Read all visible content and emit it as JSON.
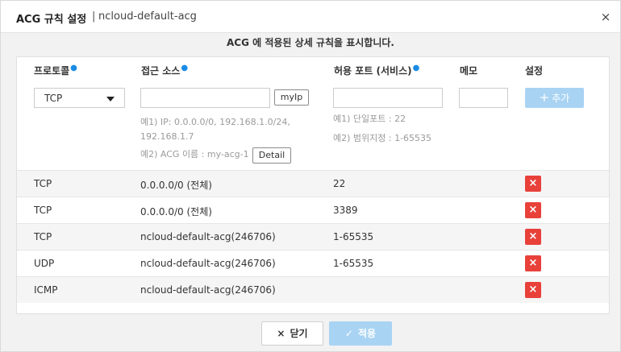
{
  "dialog": {
    "title": "ACG 규칙 설정",
    "separator": "|",
    "acg_name": "ncloud-default-acg",
    "close_icon": "×"
  },
  "description": "ACG 에 적용된 상세 규칙을 표시합니다.",
  "columns": {
    "protocol": "프로토콜",
    "source": "접근 소스",
    "port": "허용 포트 (서비스)",
    "memo": "메모",
    "setting": "설정"
  },
  "form": {
    "protocol_selected": "TCP",
    "source_value": "",
    "myip_button": "myIp",
    "source_hint_1": "예1) IP: 0.0.0.0/0, 192.168.1.0/24,",
    "source_hint_1b": "192.168.1.7",
    "source_hint_2": "예2) ACG 이름 : my-acg-1",
    "detail_button": "Detail",
    "port_value": "",
    "port_hint_1": "예1) 단일포트 : 22",
    "port_hint_2": "예2) 범위지정 : 1-65535",
    "memo_value": "",
    "add_button": "추가",
    "add_icon": "+"
  },
  "rules": [
    {
      "protocol": "TCP",
      "source": "0.0.0.0/0 (전체)",
      "port": "22",
      "delete_icon": "×"
    },
    {
      "protocol": "TCP",
      "source": "0.0.0.0/0 (전체)",
      "port": "3389",
      "delete_icon": "×"
    },
    {
      "protocol": "TCP",
      "source": "ncloud-default-acg(246706)",
      "port": "1-65535",
      "delete_icon": "×"
    },
    {
      "protocol": "UDP",
      "source": "ncloud-default-acg(246706)",
      "port": "1-65535",
      "delete_icon": "×"
    },
    {
      "protocol": "ICMP",
      "source": "ncloud-default-acg(246706)",
      "port": "",
      "delete_icon": "×"
    }
  ],
  "footer": {
    "close_label": "닫기",
    "close_icon": "×",
    "apply_label": "적용",
    "apply_icon": "✓"
  },
  "colors": {
    "accent": "#1a8be4",
    "add_button": "#a9d3f3",
    "delete_button": "#e8413a"
  }
}
